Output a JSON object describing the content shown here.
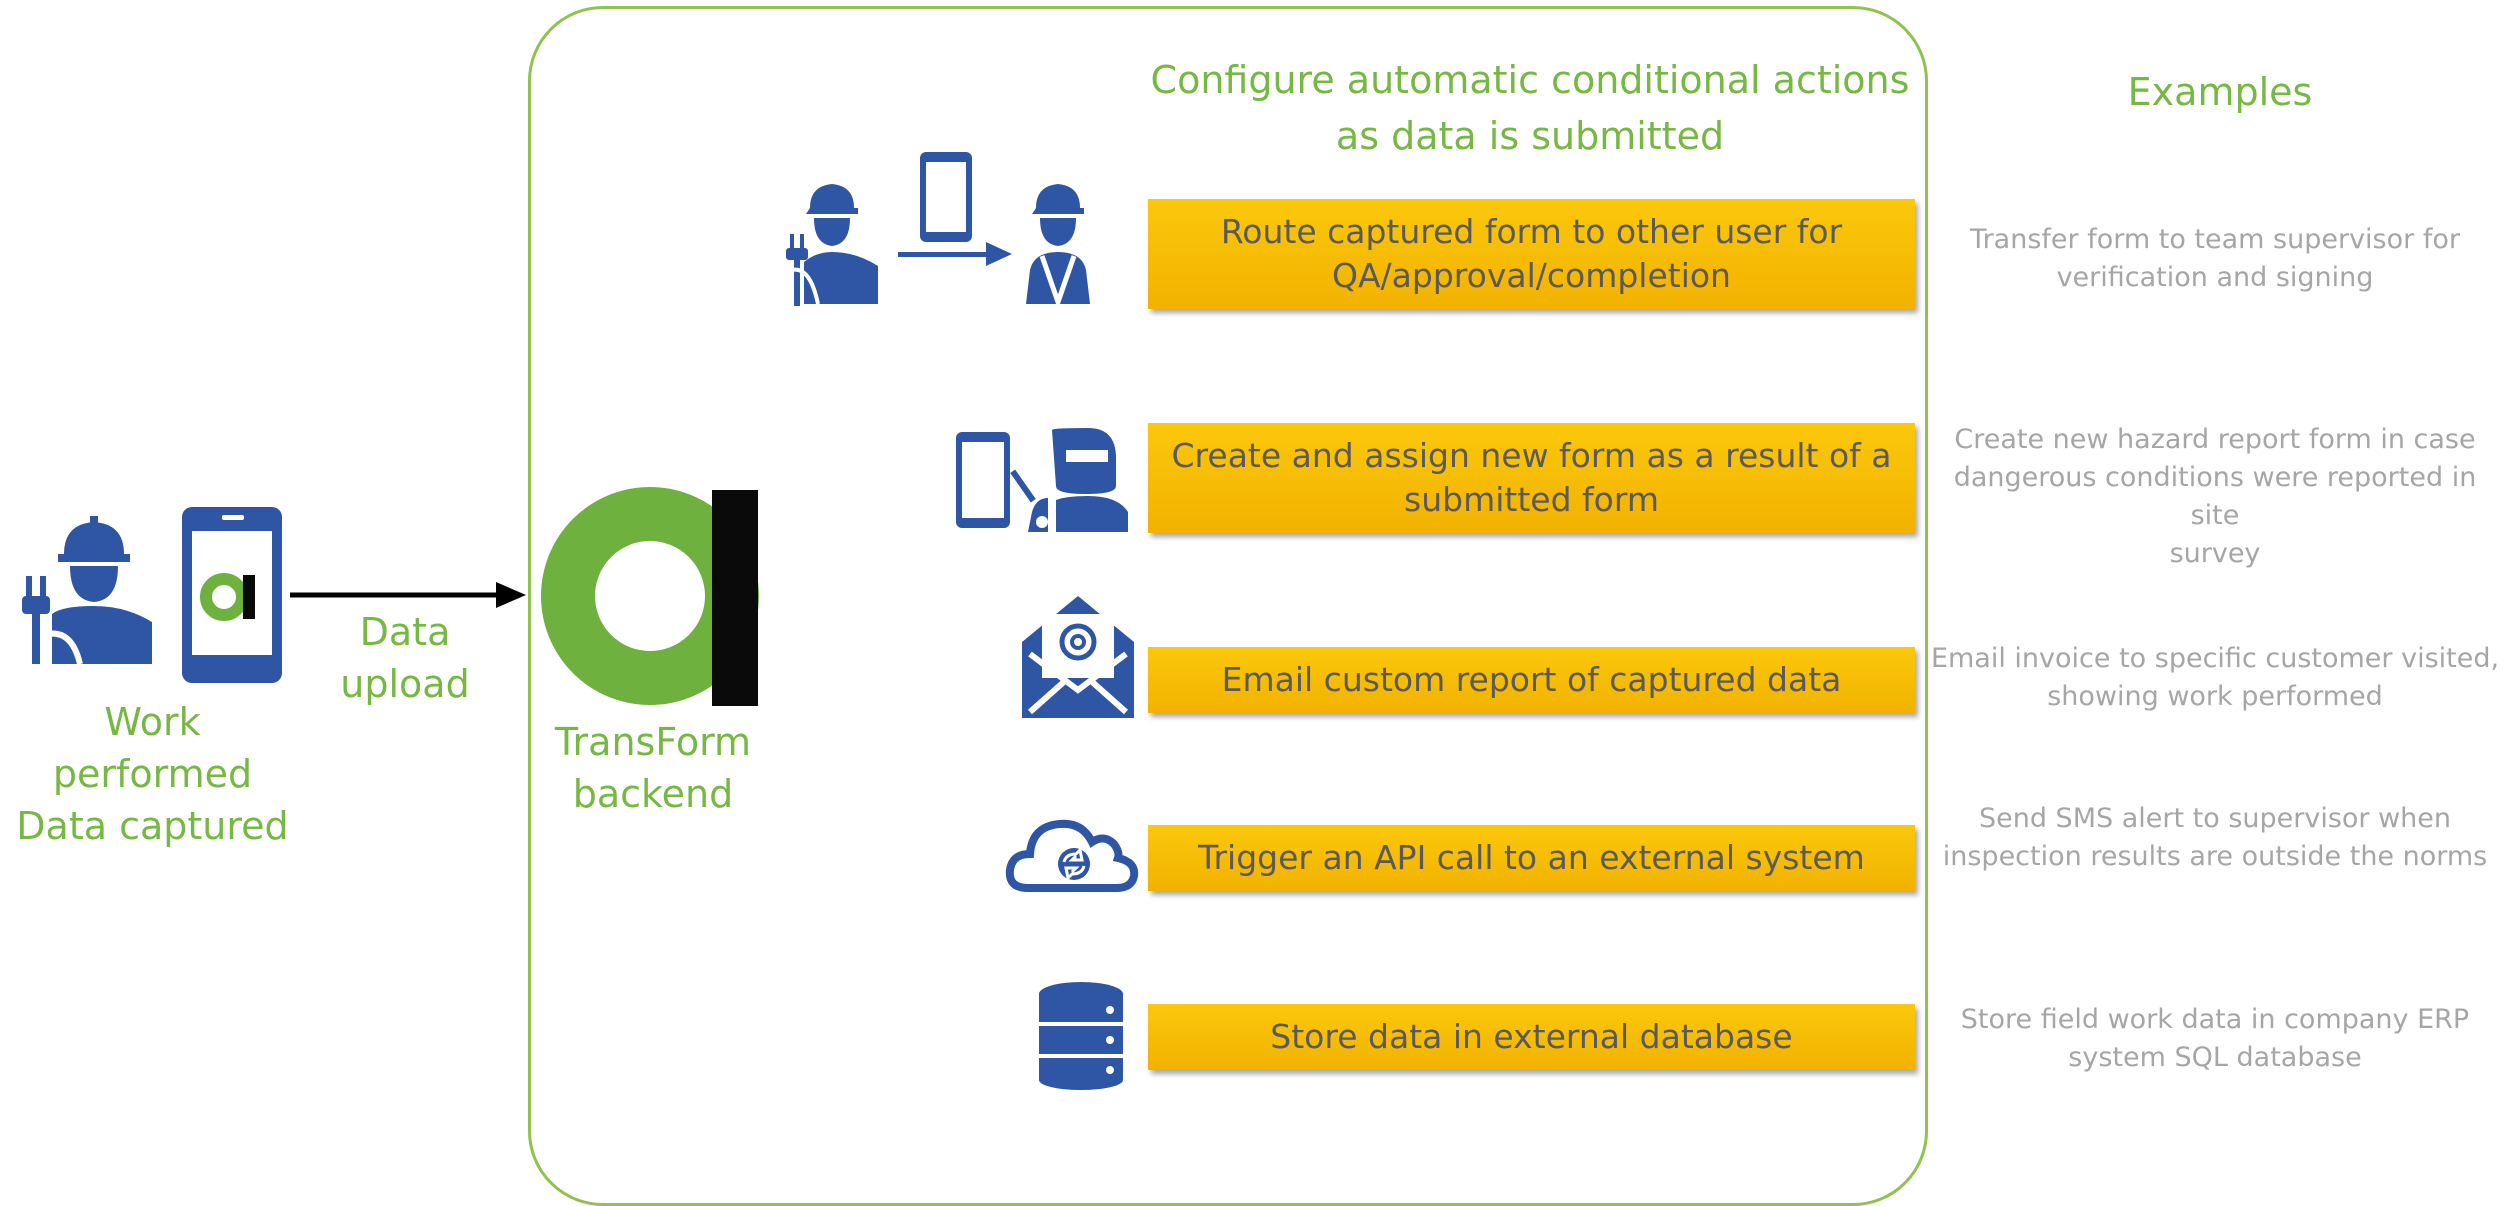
{
  "header": {
    "title_line1": "Configure automatic conditional actions",
    "title_line2": "as data is submitted",
    "examples_title": "Examples"
  },
  "left": {
    "caption_line1": "Work performed",
    "caption_line2": "Data captured",
    "upload_line1": "Data",
    "upload_line2": "upload"
  },
  "backend": {
    "label_line1": "TransForm",
    "label_line2": "backend"
  },
  "actions": [
    {
      "line1": "Route captured form to other user for",
      "line2": "QA/approval/completion",
      "icon": "worker-phone-handoff-icon"
    },
    {
      "line1": "Create and assign new form as a result of a",
      "line2": "submitted form",
      "icon": "phone-welder-icon"
    },
    {
      "line1": "Email custom report of captured data",
      "line2": "",
      "icon": "email-envelope-icon"
    },
    {
      "line1": "Trigger an API call to an external system",
      "line2": "",
      "icon": "cloud-sync-icon"
    },
    {
      "line1": "Store data in external database",
      "line2": "",
      "icon": "database-icon"
    }
  ],
  "examples": [
    {
      "line1": "Transfer form to team supervisor for",
      "line2": "verification and signing",
      "line3": ""
    },
    {
      "line1": "Create new hazard report form in case",
      "line2": "dangerous conditions were reported in site",
      "line3": "survey"
    },
    {
      "line1": "Email invoice to specific customer visited,",
      "line2": "showing work performed",
      "line3": ""
    },
    {
      "line1": "Send SMS alert to supervisor when",
      "line2": "inspection results are outside the norms",
      "line3": ""
    },
    {
      "line1": "Store field work data in company ERP",
      "line2": "system SQL database",
      "line3": ""
    }
  ],
  "colors": {
    "accent_green": "#77b843",
    "icon_blue": "#2f56a4",
    "action_yellow": "#fbc80b",
    "example_grey": "#a6a6a6"
  }
}
